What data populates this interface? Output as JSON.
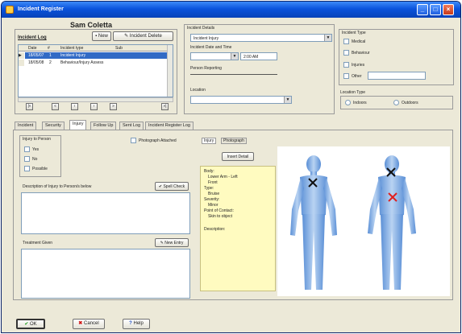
{
  "window": {
    "title": "Incident Register"
  },
  "patient": {
    "name": "Sam Coletta"
  },
  "log": {
    "heading": "Incident Log",
    "new_button": "New",
    "delete_button": "Incident Delete",
    "columns": [
      "Date",
      "#",
      "Incident type",
      "Sub"
    ],
    "rows": [
      {
        "date": "18/05/07",
        "num": "1",
        "type": "Incident Injury",
        "selected": true
      },
      {
        "date": "18/05/08",
        "num": "2",
        "type": "Behaviour/Injury Assess",
        "selected": false
      }
    ],
    "nav_buttons": [
      "|«",
      "«",
      "‹",
      "›",
      "»",
      "»|"
    ]
  },
  "details": {
    "group_label": "Incident Details",
    "type_select": "Incident Injury",
    "date_time_label": "Incident Date and Time",
    "date_value": "",
    "time_value": "2:00 AM",
    "reported_label": "Person Reporting",
    "location_label": "Location"
  },
  "incident_type": {
    "label": "Incident Type",
    "options": [
      "Medical",
      "Behaviour",
      "Injuries",
      "Other"
    ]
  },
  "location_type": {
    "label": "Location Type",
    "options": [
      "Indoors",
      "Outdoors"
    ]
  },
  "tabs": [
    "Incident",
    "Security",
    "Injury",
    "Follow Up",
    "Sent Log",
    "Incident Register Log"
  ],
  "injury": {
    "group_label": "Injury to Person",
    "options": [
      "Yes",
      "No",
      "Possible"
    ],
    "photo_label": "Photograph Attached",
    "sub_tabs": [
      "Injury",
      "Photograph"
    ],
    "insert_button": "Insert Detail",
    "description_label": "Description of Injury to Person/s below",
    "spell_button": "Spell Check",
    "treatment_label": "Treatment Given",
    "new_button": "New Entry",
    "notes_lines": [
      "Body:",
      "Lower Arm - Left",
      "Front",
      "Type:",
      "Bruise",
      "Severity:",
      "Minor",
      "Point of Contact:",
      "Skin to object",
      "",
      "Description:"
    ]
  },
  "footer": {
    "ok": "OK",
    "cancel": "Cancel",
    "help": "Help"
  },
  "colors": {
    "title_bar": "#0a53dc",
    "selection": "#316ac5",
    "notes_bg": "#fffbc0",
    "body_figure": "#8fb8e8",
    "mark_black": "#111111",
    "mark_red": "#e02020"
  }
}
